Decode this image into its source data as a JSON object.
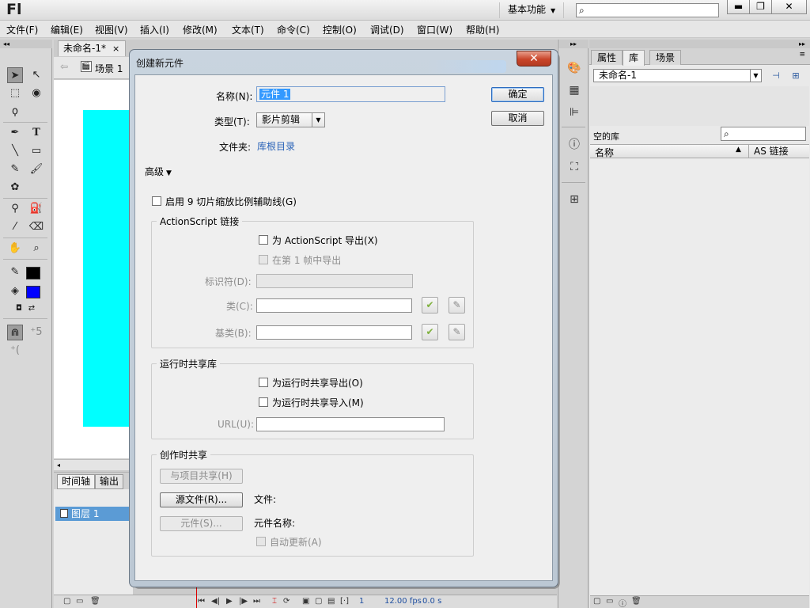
{
  "app": {
    "logo": "Fl",
    "workspace": "基本功能",
    "search_placeholder": "",
    "window_buttons": {
      "minimize": "▬",
      "maximize": "❐",
      "close": "✕"
    }
  },
  "menu": [
    "文件(F)",
    "编辑(E)",
    "视图(V)",
    "插入(I)",
    "修改(M)",
    "文本(T)",
    "命令(C)",
    "控制(O)",
    "调试(D)",
    "窗口(W)",
    "帮助(H)"
  ],
  "document": {
    "tab_label": "未命名-1*",
    "tab_close": "×",
    "scene_label": "场景 1"
  },
  "tools": {
    "stroke_color": "#000000",
    "fill_color": "#0000ff"
  },
  "stage": {
    "shape_color": "#00ffff"
  },
  "timeline": {
    "tabs": [
      "时间轴",
      "输出"
    ],
    "layer_name": "图层 1",
    "frame": "1",
    "fps": "12.00 fps",
    "time": "0.0 s"
  },
  "library": {
    "tabs": [
      "属性",
      "库",
      "场景"
    ],
    "active_tab": "库",
    "document_select": "未命名-1",
    "empty_label": "空的库",
    "columns": {
      "name": "名称",
      "linkage": "AS 链接"
    }
  },
  "dialog": {
    "title": "创建新元件",
    "close": "✕",
    "name_label": "名称(N):",
    "name_value": "元件 1",
    "type_label": "类型(T):",
    "type_value": "影片剪辑",
    "folder_label": "文件夹:",
    "folder_value": "库根目录",
    "ok_button": "确定",
    "cancel_button": "取消",
    "advanced_label": "高级",
    "scale9_label": "启用 9 切片缩放比例辅助线(G)",
    "actionscript": {
      "group_title": "ActionScript 链接",
      "export_label": "为 ActionScript 导出(X)",
      "export_first_frame_label": "在第 1 帧中导出",
      "identifier_label": "标识符(D):",
      "class_label": "类(C):",
      "base_class_label": "基类(B):"
    },
    "runtime_sharing": {
      "group_title": "运行时共享库",
      "export_label": "为运行时共享导出(O)",
      "import_label": "为运行时共享导入(M)",
      "url_label": "URL(U):"
    },
    "authortime_sharing": {
      "group_title": "创作时共享",
      "share_button": "与项目共享(H)",
      "source_button": "源文件(R)...",
      "file_label": "文件:",
      "symbol_button": "元件(S)...",
      "symbol_name_label": "元件名称:",
      "auto_update_label": "自动更新(A)"
    }
  }
}
